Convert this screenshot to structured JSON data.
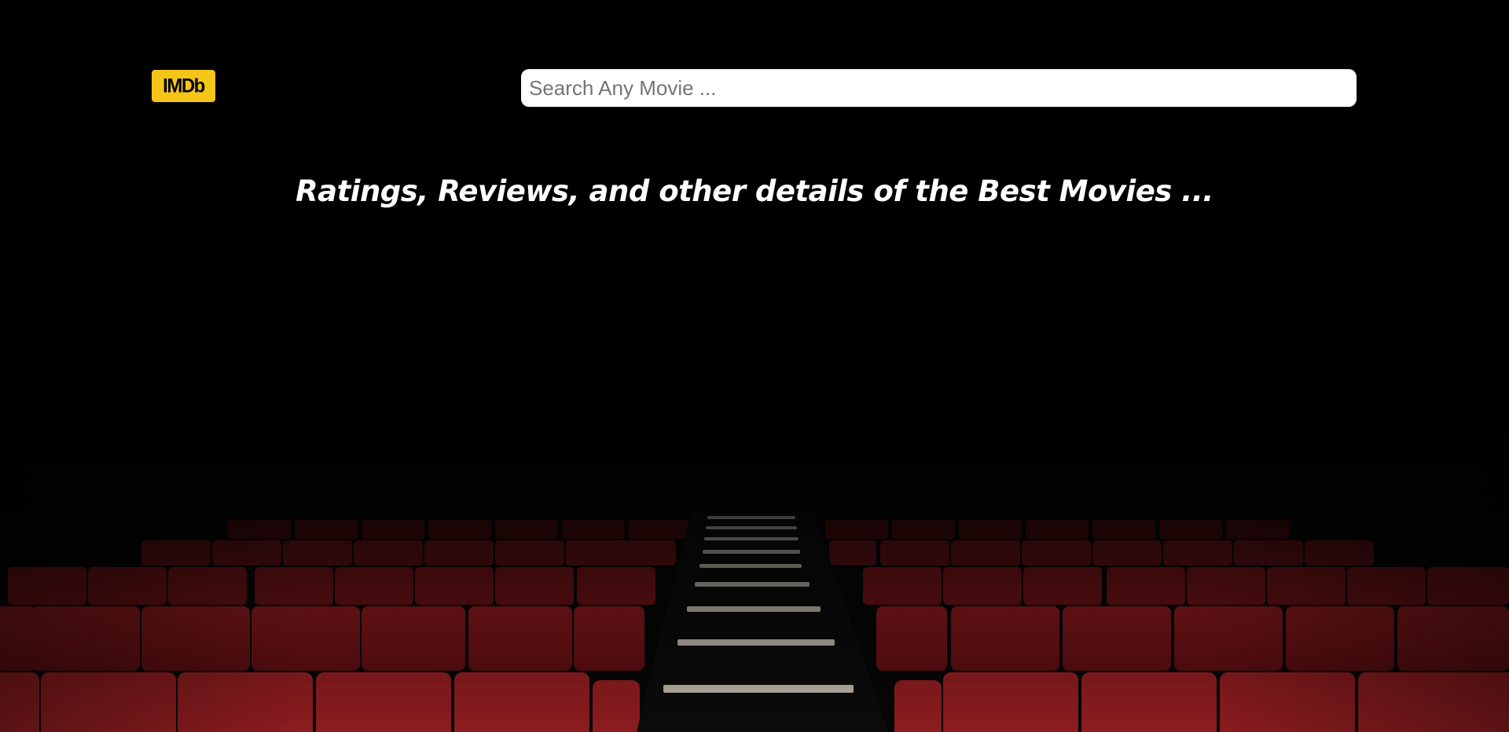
{
  "header": {
    "logo_text": "IMDb",
    "brand_color": "#f5c518"
  },
  "search": {
    "placeholder": "Search Any Movie ...",
    "value": ""
  },
  "hero": {
    "tagline": "Ratings, Reviews, and other details of the Best Movies ..."
  },
  "background": {
    "description_icon": "theater-seats-image",
    "seat_color": "#7a1417",
    "base_color": "#000000"
  }
}
